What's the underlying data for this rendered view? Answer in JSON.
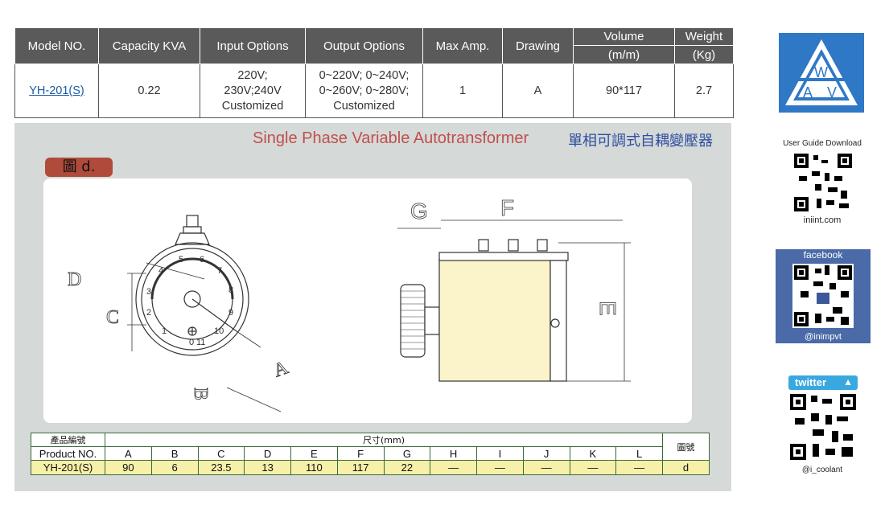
{
  "spec_table": {
    "headers": [
      "Model NO.",
      "Capacity KVA",
      "Input Options",
      "Output Options",
      "Max Amp.",
      "Drawing",
      "Volume",
      "Weight"
    ],
    "volume_unit": "(m/m)",
    "weight_unit": "(Kg)",
    "row": {
      "model": "YH-201(S)",
      "capacity": "0.22",
      "input": [
        "220V;",
        "230V;240V",
        "Customized"
      ],
      "output": [
        "0~220V; 0~240V;",
        "0~260V; 0~280V;",
        "Customized"
      ],
      "max_amp": "1",
      "drawing": "A",
      "volume": "90*117",
      "weight": "2.7"
    }
  },
  "panel": {
    "title_en": "Single Phase Variable Autotransformer",
    "title_cn": "單相可調式自耦變壓器",
    "figure_label": "圖 d.",
    "drawing_labels": {
      "dial_numbers": [
        "0",
        "1",
        "2",
        "3",
        "4",
        "5",
        "6",
        "7",
        "8",
        "9",
        "10",
        "11"
      ],
      "left": [
        "D",
        "C",
        "B",
        "A"
      ],
      "right": [
        "G",
        "F",
        "E"
      ]
    }
  },
  "dims_table": {
    "product_cn": "產品編號",
    "product_en": "Product NO.",
    "size_header": "尺寸(mm)",
    "figure_header": "圖號",
    "letters": [
      "A",
      "B",
      "C",
      "D",
      "E",
      "F",
      "G",
      "H",
      "I",
      "J",
      "K",
      "L"
    ],
    "model": "YH-201(S)",
    "values": [
      "90",
      "6",
      "23.5",
      "13",
      "110",
      "117",
      "22",
      "—",
      "—",
      "—",
      "—",
      "—"
    ],
    "figure": "d"
  },
  "sidebar": {
    "logo_letters": [
      "W",
      "A",
      "V"
    ],
    "guide_label": "User Guide Download",
    "guide_site": "iniint.com",
    "facebook_label": "facebook",
    "facebook_handle": "@inimpvt",
    "twitter_label": "twitter",
    "twitter_handle": "@i_coolant"
  },
  "colors": {
    "header_bg": "#5a5a5a",
    "panel_bg": "#d5d9d8",
    "title_red": "#c0504d",
    "title_blue": "#2f4ea0",
    "logo_blue": "#2f78c6",
    "facebook_blue": "#4a6aa8",
    "twitter_blue": "#3aa8e0",
    "dims_value_bg": "#f6f0a8"
  }
}
